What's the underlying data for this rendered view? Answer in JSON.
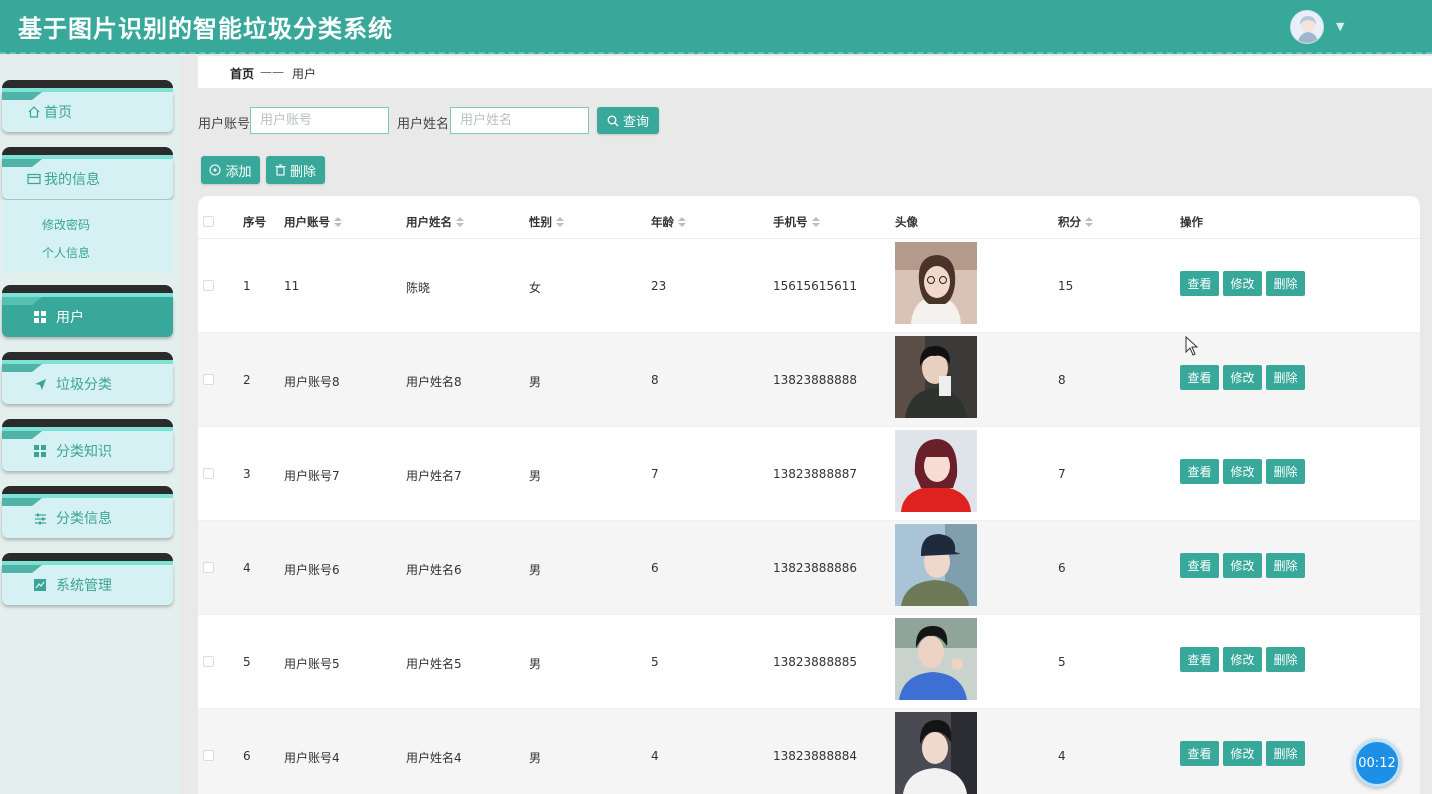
{
  "header": {
    "title": "基于图片识别的智能垃圾分类系统",
    "avatar_icon": "user-avatar",
    "caret": "▼"
  },
  "sidebar": {
    "items": [
      {
        "label": "首页",
        "icon": "home-icon"
      },
      {
        "label": "我的信息",
        "icon": "id-card-icon"
      },
      {
        "label": "用户",
        "icon": "grid-icon",
        "active": true
      },
      {
        "label": "垃圾分类",
        "icon": "send-icon"
      },
      {
        "label": "分类知识",
        "icon": "grid-icon"
      },
      {
        "label": "分类信息",
        "icon": "sliders-icon"
      },
      {
        "label": "系统管理",
        "icon": "chart-icon"
      }
    ],
    "submenu": [
      "修改密码",
      "个人信息"
    ]
  },
  "breadcrumb": {
    "home": "首页",
    "separator": "——",
    "current": "用户"
  },
  "search": {
    "account_label": "用户账号",
    "account_placeholder": "用户账号",
    "name_label": "用户姓名",
    "name_placeholder": "用户姓名",
    "query_button": "查询"
  },
  "toolbar": {
    "add_button": "添加",
    "delete_button": "删除"
  },
  "table": {
    "columns": [
      "序号",
      "用户账号",
      "用户姓名",
      "性别",
      "年龄",
      "手机号",
      "头像",
      "积分",
      "操作"
    ],
    "rows": [
      {
        "index": "1",
        "account": "11",
        "name": "陈晓",
        "gender": "女",
        "age": "23",
        "phone": "15615615611",
        "points": "15"
      },
      {
        "index": "2",
        "account": "用户账号8",
        "name": "用户姓名8",
        "gender": "男",
        "age": "8",
        "phone": "13823888888",
        "points": "8"
      },
      {
        "index": "3",
        "account": "用户账号7",
        "name": "用户姓名7",
        "gender": "男",
        "age": "7",
        "phone": "13823888887",
        "points": "7"
      },
      {
        "index": "4",
        "account": "用户账号6",
        "name": "用户姓名6",
        "gender": "男",
        "age": "6",
        "phone": "13823888886",
        "points": "6"
      },
      {
        "index": "5",
        "account": "用户账号5",
        "name": "用户姓名5",
        "gender": "男",
        "age": "5",
        "phone": "13823888885",
        "points": "5"
      },
      {
        "index": "6",
        "account": "用户账号4",
        "name": "用户姓名4",
        "gender": "男",
        "age": "4",
        "phone": "13823888884",
        "points": "4"
      }
    ],
    "actions": {
      "view": "查看",
      "edit": "修改",
      "delete": "删除"
    }
  },
  "timer": "00:12",
  "colors": {
    "accent": "#37a89a",
    "sidebar_card": "#d6f1f3",
    "timer": "#1e8fe6"
  }
}
